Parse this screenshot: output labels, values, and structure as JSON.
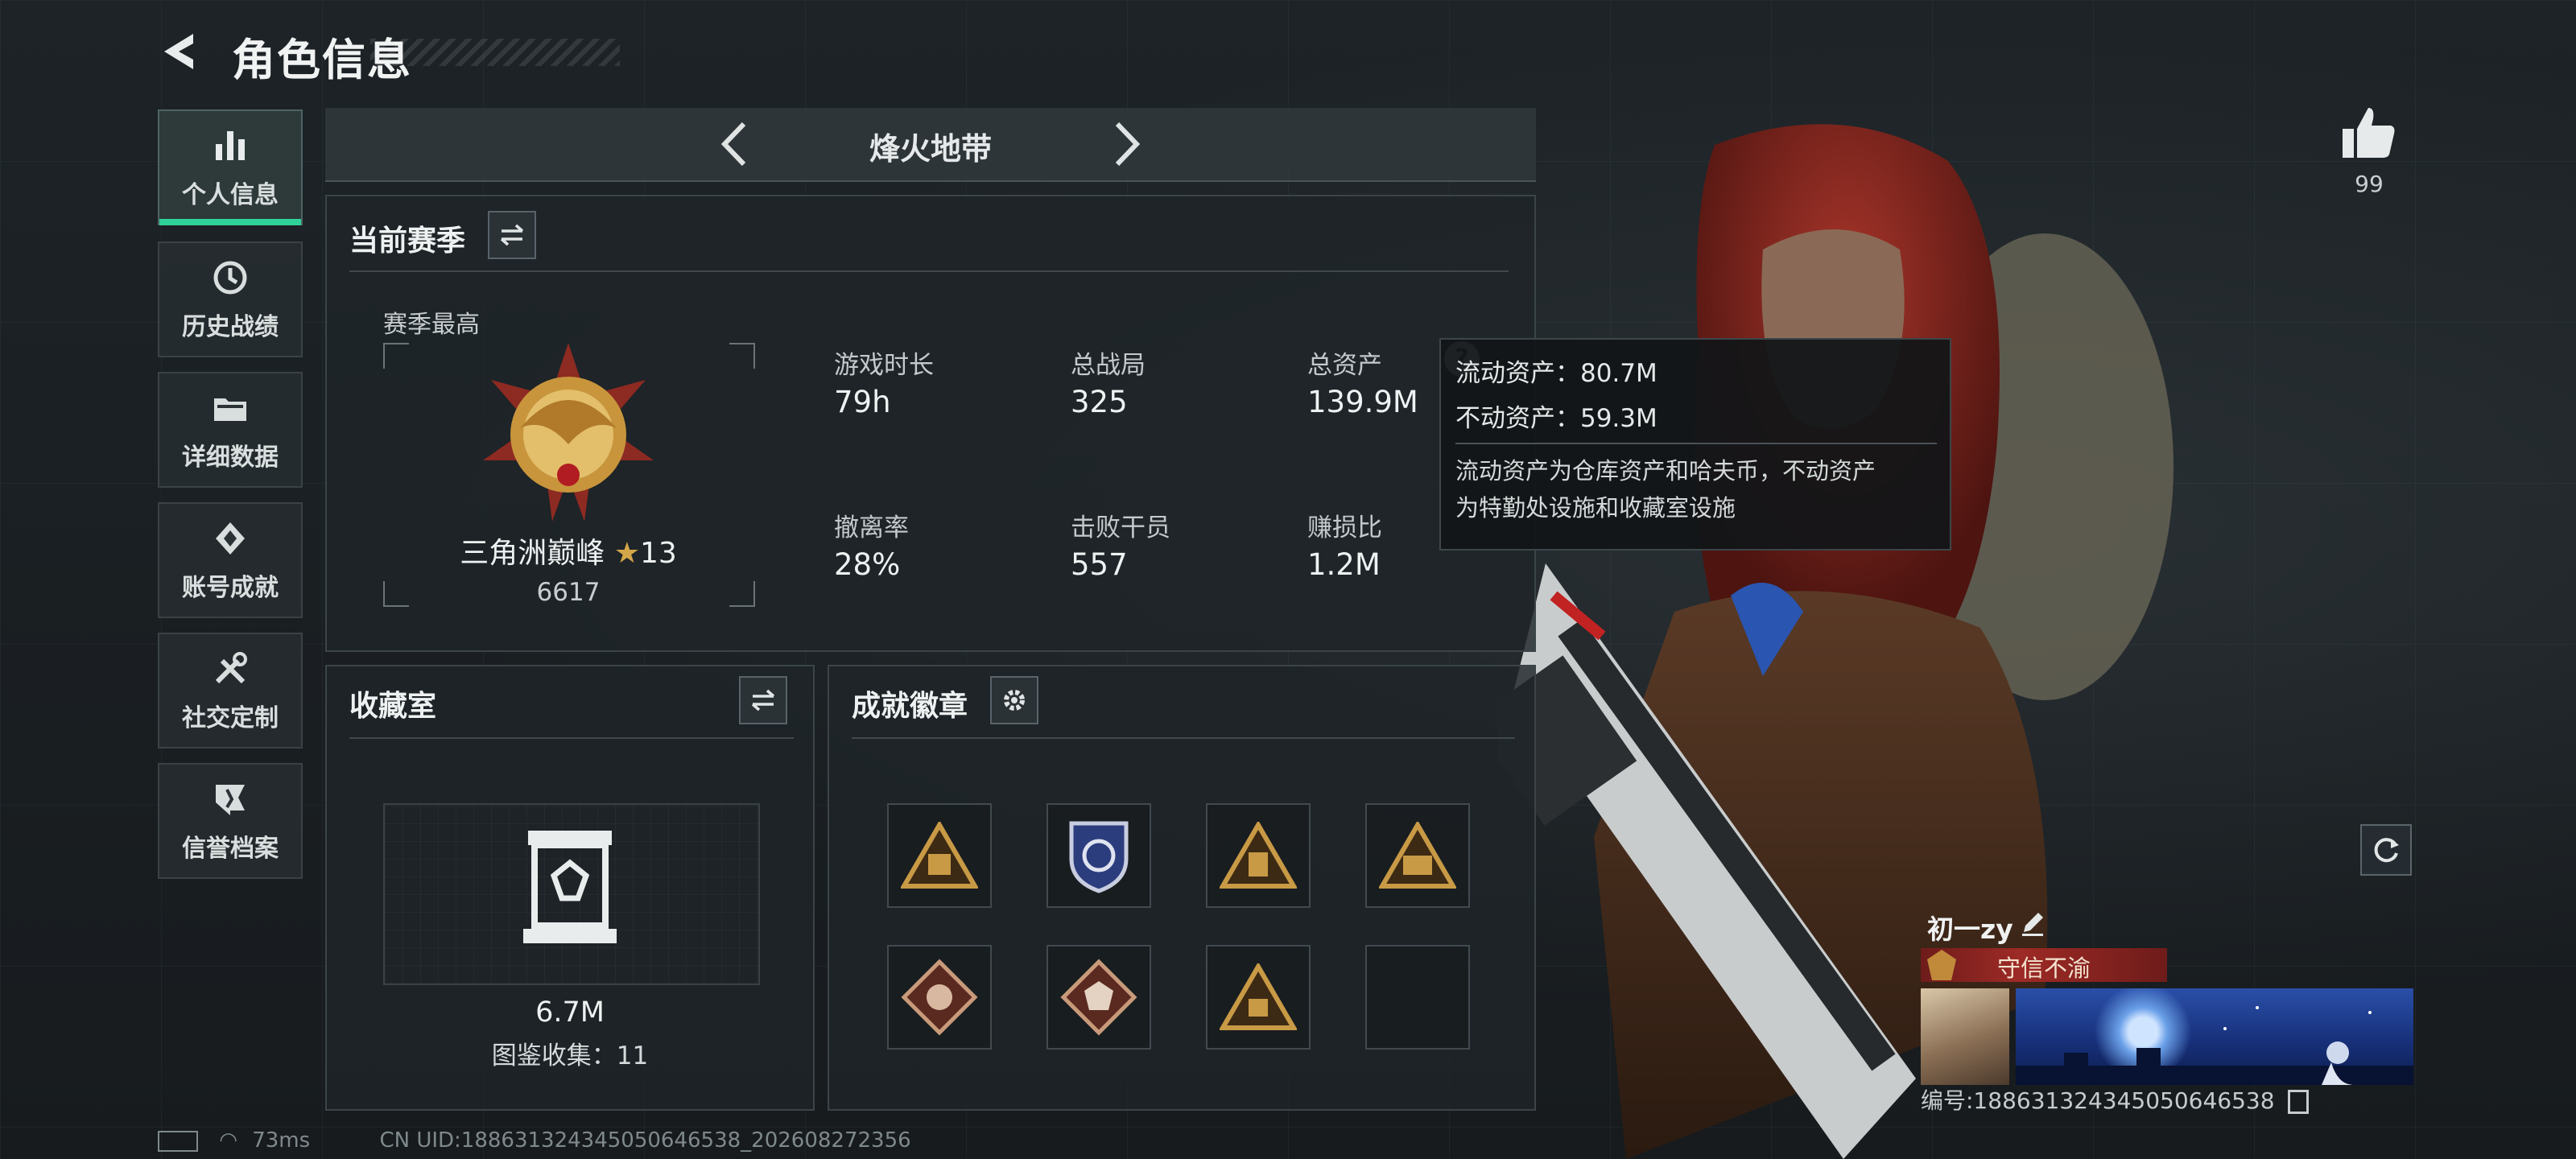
{
  "header": {
    "title": "角色信息"
  },
  "nav": {
    "items": [
      {
        "label": "个人信息",
        "icon": "bar-chart-icon",
        "active": true
      },
      {
        "label": "历史战绩",
        "icon": "history-icon",
        "active": false
      },
      {
        "label": "详细数据",
        "icon": "folder-icon",
        "active": false
      },
      {
        "label": "账号成就",
        "icon": "achievement-icon",
        "active": false
      },
      {
        "label": "社交定制",
        "icon": "tools-icon",
        "active": false
      },
      {
        "label": "信誉档案",
        "icon": "shield-flag-icon",
        "active": false
      }
    ]
  },
  "mode": {
    "name": "烽火地带"
  },
  "season": {
    "title": "当前赛季",
    "peak_label": "赛季最高",
    "rank_name": "三角洲巅峰",
    "rank_stars": "13",
    "rank_score": "6617",
    "stats": [
      {
        "label": "游戏时长",
        "value": "79h"
      },
      {
        "label": "总战局",
        "value": "325"
      },
      {
        "label": "总资产",
        "value": "139.9M"
      },
      {
        "label": "撤离率",
        "value": "28%"
      },
      {
        "label": "击败干员",
        "value": "557"
      },
      {
        "label": "赚损比",
        "value": "1.2M"
      }
    ]
  },
  "tooltip": {
    "liquid": "流动资产：80.7M",
    "fixed": "不动资产：59.3M",
    "note_line1": "流动资产为仓库资产和哈夫币，不动资产",
    "note_line2": "为特勤处设施和收藏室设施"
  },
  "collection": {
    "title": "收藏室",
    "value": "6.7M",
    "catalog": "图鉴收集：11"
  },
  "badges": {
    "title": "成就徽章",
    "items": [
      "triangle-badge-icon",
      "shield-badge-icon",
      "triangle-badge-icon",
      "triangle-badge-icon",
      "diamond-badge-icon",
      "diamond-badge-icon",
      "triangle-badge-icon",
      ""
    ]
  },
  "likes": {
    "count": "99"
  },
  "player": {
    "name": "初一zy",
    "title": "守信不渝",
    "uid_line": "编号:188631324345050646538"
  },
  "status": {
    "ping": "73ms",
    "cn_uid": "CN UID:188631324345050646538_202608272356"
  },
  "colors": {
    "accent": "#2fd39a",
    "title_red": "#9d2a26",
    "rank_gold": "#d4a64a"
  }
}
